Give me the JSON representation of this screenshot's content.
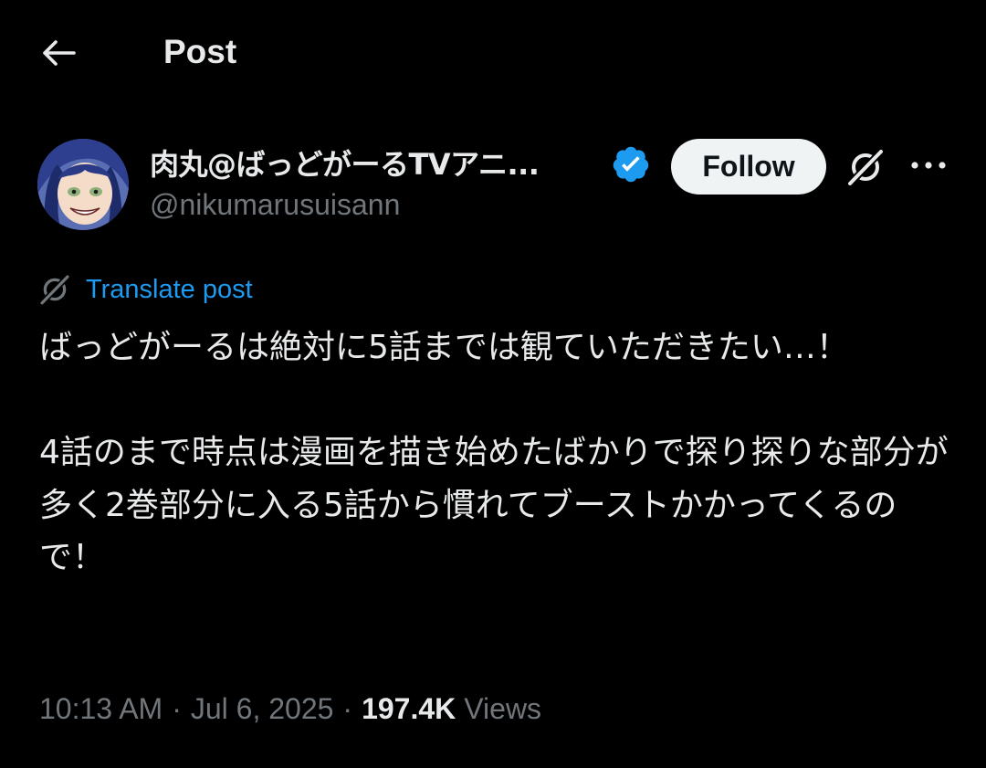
{
  "header": {
    "back_icon": "arrow-left-icon",
    "title": "Post"
  },
  "author": {
    "avatar": "avatar",
    "display_name": "肉丸@ばっどがーるTVアニ...",
    "verified_icon": "verified-badge-icon",
    "handle": "@nikumarusuisann"
  },
  "actions": {
    "follow_label": "Follow",
    "grok_icon": "grok-icon",
    "more_icon": "more-horizontal-icon"
  },
  "translate": {
    "icon": "grok-icon",
    "label": "Translate post"
  },
  "post": {
    "text": "ばっどがーるは絶対に5話までは観ていただきたい…！\n\n4話のまで時点は漫画を描き始めたばかりで探り探りな部分が多く2巻部分に入る5話から慣れてブーストかかってくるので！"
  },
  "meta": {
    "time": "10:13 AM",
    "separator": "·",
    "date": "Jul 6, 2025",
    "views_count": "197.4K",
    "views_label": "Views"
  },
  "colors": {
    "background": "#000000",
    "text_primary": "#e7e9ea",
    "text_secondary": "#71767b",
    "accent": "#1d9bf0",
    "follow_bg": "#eff3f4"
  }
}
